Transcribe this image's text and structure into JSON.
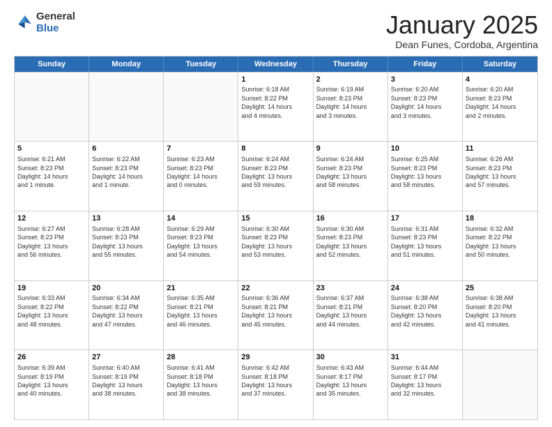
{
  "logo": {
    "general": "General",
    "blue": "Blue"
  },
  "title": "January 2025",
  "location": "Dean Funes, Cordoba, Argentina",
  "header_days": [
    "Sunday",
    "Monday",
    "Tuesday",
    "Wednesday",
    "Thursday",
    "Friday",
    "Saturday"
  ],
  "weeks": [
    [
      {
        "day": "",
        "text": ""
      },
      {
        "day": "",
        "text": ""
      },
      {
        "day": "",
        "text": ""
      },
      {
        "day": "1",
        "text": "Sunrise: 6:18 AM\nSunset: 8:22 PM\nDaylight: 14 hours\nand 4 minutes."
      },
      {
        "day": "2",
        "text": "Sunrise: 6:19 AM\nSunset: 8:23 PM\nDaylight: 14 hours\nand 3 minutes."
      },
      {
        "day": "3",
        "text": "Sunrise: 6:20 AM\nSunset: 8:23 PM\nDaylight: 14 hours\nand 3 minutes."
      },
      {
        "day": "4",
        "text": "Sunrise: 6:20 AM\nSunset: 8:23 PM\nDaylight: 14 hours\nand 2 minutes."
      }
    ],
    [
      {
        "day": "5",
        "text": "Sunrise: 6:21 AM\nSunset: 8:23 PM\nDaylight: 14 hours\nand 1 minute."
      },
      {
        "day": "6",
        "text": "Sunrise: 6:22 AM\nSunset: 8:23 PM\nDaylight: 14 hours\nand 1 minute."
      },
      {
        "day": "7",
        "text": "Sunrise: 6:23 AM\nSunset: 8:23 PM\nDaylight: 14 hours\nand 0 minutes."
      },
      {
        "day": "8",
        "text": "Sunrise: 6:24 AM\nSunset: 8:23 PM\nDaylight: 13 hours\nand 59 minutes."
      },
      {
        "day": "9",
        "text": "Sunrise: 6:24 AM\nSunset: 8:23 PM\nDaylight: 13 hours\nand 58 minutes."
      },
      {
        "day": "10",
        "text": "Sunrise: 6:25 AM\nSunset: 8:23 PM\nDaylight: 13 hours\nand 58 minutes."
      },
      {
        "day": "11",
        "text": "Sunrise: 6:26 AM\nSunset: 8:23 PM\nDaylight: 13 hours\nand 57 minutes."
      }
    ],
    [
      {
        "day": "12",
        "text": "Sunrise: 6:27 AM\nSunset: 8:23 PM\nDaylight: 13 hours\nand 56 minutes."
      },
      {
        "day": "13",
        "text": "Sunrise: 6:28 AM\nSunset: 8:23 PM\nDaylight: 13 hours\nand 55 minutes."
      },
      {
        "day": "14",
        "text": "Sunrise: 6:29 AM\nSunset: 8:23 PM\nDaylight: 13 hours\nand 54 minutes."
      },
      {
        "day": "15",
        "text": "Sunrise: 6:30 AM\nSunset: 8:23 PM\nDaylight: 13 hours\nand 53 minutes."
      },
      {
        "day": "16",
        "text": "Sunrise: 6:30 AM\nSunset: 8:23 PM\nDaylight: 13 hours\nand 52 minutes."
      },
      {
        "day": "17",
        "text": "Sunrise: 6:31 AM\nSunset: 8:23 PM\nDaylight: 13 hours\nand 51 minutes."
      },
      {
        "day": "18",
        "text": "Sunrise: 6:32 AM\nSunset: 8:22 PM\nDaylight: 13 hours\nand 50 minutes."
      }
    ],
    [
      {
        "day": "19",
        "text": "Sunrise: 6:33 AM\nSunset: 8:22 PM\nDaylight: 13 hours\nand 48 minutes."
      },
      {
        "day": "20",
        "text": "Sunrise: 6:34 AM\nSunset: 8:22 PM\nDaylight: 13 hours\nand 47 minutes."
      },
      {
        "day": "21",
        "text": "Sunrise: 6:35 AM\nSunset: 8:21 PM\nDaylight: 13 hours\nand 46 minutes."
      },
      {
        "day": "22",
        "text": "Sunrise: 6:36 AM\nSunset: 8:21 PM\nDaylight: 13 hours\nand 45 minutes."
      },
      {
        "day": "23",
        "text": "Sunrise: 6:37 AM\nSunset: 8:21 PM\nDaylight: 13 hours\nand 44 minutes."
      },
      {
        "day": "24",
        "text": "Sunrise: 6:38 AM\nSunset: 8:20 PM\nDaylight: 13 hours\nand 42 minutes."
      },
      {
        "day": "25",
        "text": "Sunrise: 6:38 AM\nSunset: 8:20 PM\nDaylight: 13 hours\nand 41 minutes."
      }
    ],
    [
      {
        "day": "26",
        "text": "Sunrise: 6:39 AM\nSunset: 8:19 PM\nDaylight: 13 hours\nand 40 minutes."
      },
      {
        "day": "27",
        "text": "Sunrise: 6:40 AM\nSunset: 8:19 PM\nDaylight: 13 hours\nand 38 minutes."
      },
      {
        "day": "28",
        "text": "Sunrise: 6:41 AM\nSunset: 8:18 PM\nDaylight: 13 hours\nand 38 minutes."
      },
      {
        "day": "29",
        "text": "Sunrise: 6:42 AM\nSunset: 8:18 PM\nDaylight: 13 hours\nand 37 minutes."
      },
      {
        "day": "30",
        "text": "Sunrise: 6:43 AM\nSunset: 8:17 PM\nDaylight: 13 hours\nand 35 minutes."
      },
      {
        "day": "31",
        "text": "Sunrise: 6:44 AM\nSunset: 8:17 PM\nDaylight: 13 hours\nand 32 minutes."
      },
      {
        "day": "",
        "text": ""
      }
    ]
  ]
}
